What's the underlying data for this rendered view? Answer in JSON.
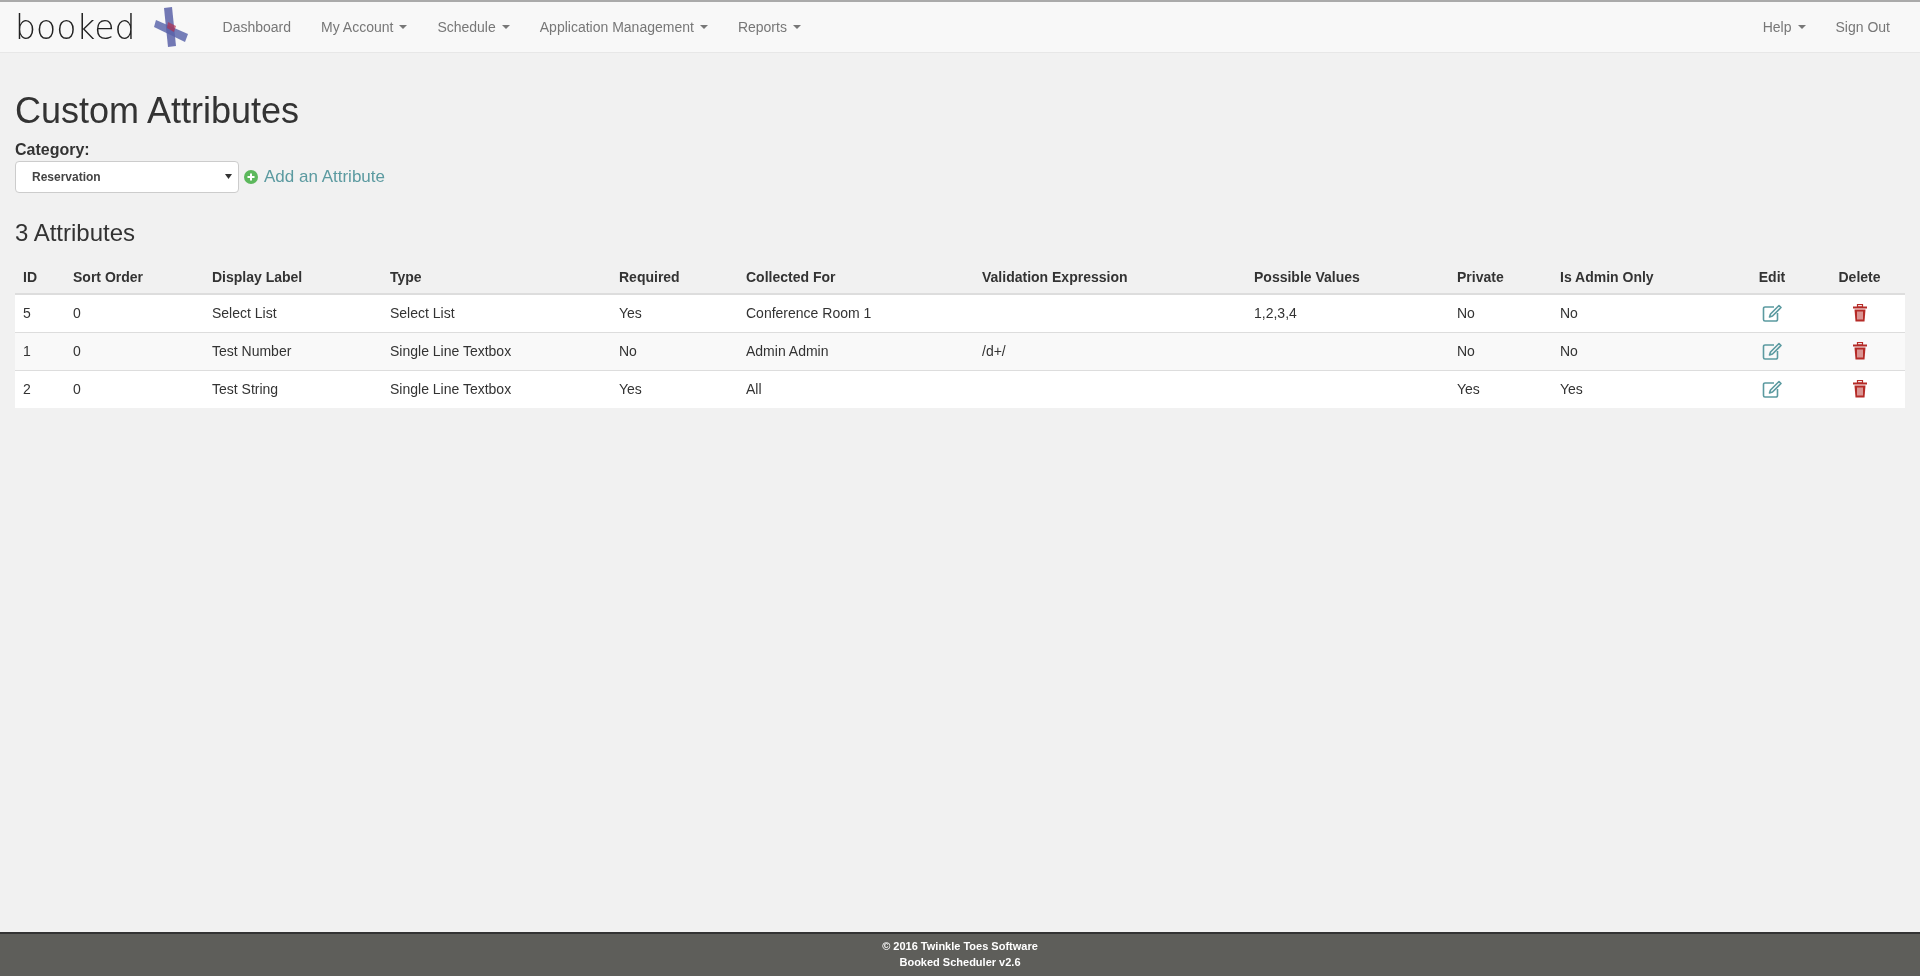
{
  "navbar": {
    "brand": "booked",
    "items": [
      {
        "label": "Dashboard",
        "dropdown": false
      },
      {
        "label": "My Account",
        "dropdown": true
      },
      {
        "label": "Schedule",
        "dropdown": true
      },
      {
        "label": "Application Management",
        "dropdown": true
      },
      {
        "label": "Reports",
        "dropdown": true
      }
    ],
    "right_items": [
      {
        "label": "Help",
        "dropdown": true
      },
      {
        "label": "Sign Out",
        "dropdown": false
      }
    ]
  },
  "page_title": "Custom Attributes",
  "category": {
    "label": "Category:",
    "value": "Reservation"
  },
  "add_link": "Add an Attribute",
  "count_heading": "3 Attributes",
  "table": {
    "columns": [
      "ID",
      "Sort Order",
      "Display Label",
      "Type",
      "Required",
      "Collected For",
      "Validation Expression",
      "Possible Values",
      "Private",
      "Is Admin Only",
      "Edit",
      "Delete"
    ],
    "rows": [
      {
        "cells": [
          "5",
          "0",
          "Select List",
          "Select List",
          "Yes",
          "Conference Room 1",
          "",
          "1,2,3,4",
          "No",
          "No"
        ]
      },
      {
        "cells": [
          "1",
          "0",
          "Test Number",
          "Single Line Textbox",
          "No",
          "Admin Admin",
          "/d+/",
          "",
          "No",
          "No"
        ]
      },
      {
        "cells": [
          "2",
          "0",
          "Test String",
          "Single Line Textbox",
          "Yes",
          "All",
          "",
          "",
          "Yes",
          "Yes"
        ]
      }
    ]
  },
  "footer": [
    "© 2016 Twinkle Toes Software",
    "Booked Scheduler v2.6"
  ]
}
